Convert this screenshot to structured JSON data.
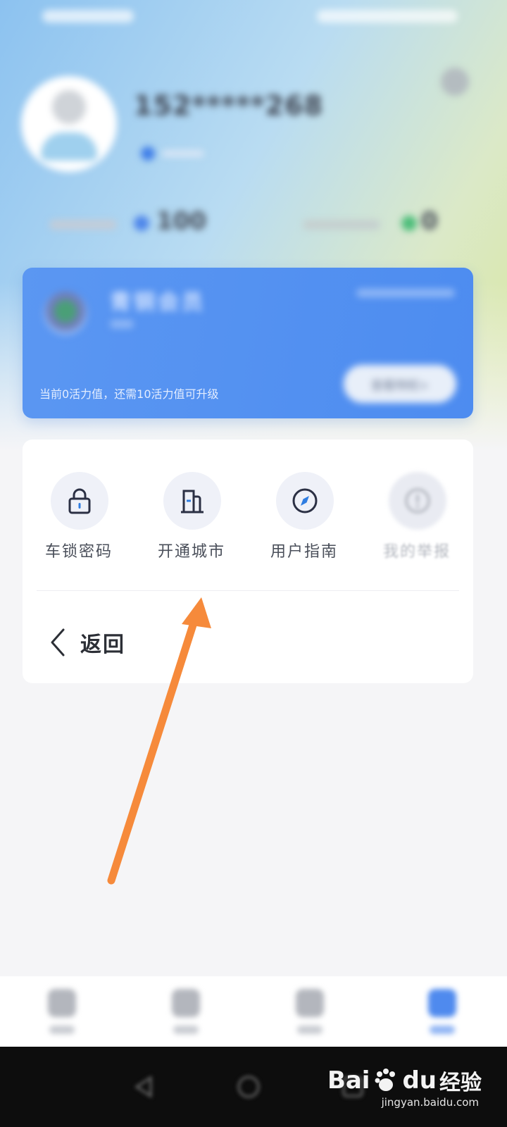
{
  "profile": {
    "username": "152*****268",
    "stat_left_value": "100",
    "stat_right_value": "0"
  },
  "vip_card": {
    "title": "青铜会员",
    "progress_text": "当前0活力值，还需10活力值可升级",
    "button_label": "查看特权>"
  },
  "menu": {
    "items": [
      {
        "label": "车锁密码",
        "icon": "lock-icon"
      },
      {
        "label": "开通城市",
        "icon": "building-icon"
      },
      {
        "label": "用户指南",
        "icon": "compass-icon"
      },
      {
        "label": "我的举报",
        "icon": "alert-icon"
      }
    ],
    "back_label": "返回"
  },
  "watermark": {
    "logo": "Bai",
    "logo_suffix": "du",
    "text": "经验",
    "url": "jingyan.baidu.com"
  },
  "colors": {
    "accent": "#4d8cf0",
    "arrow": "#f68a3b"
  }
}
